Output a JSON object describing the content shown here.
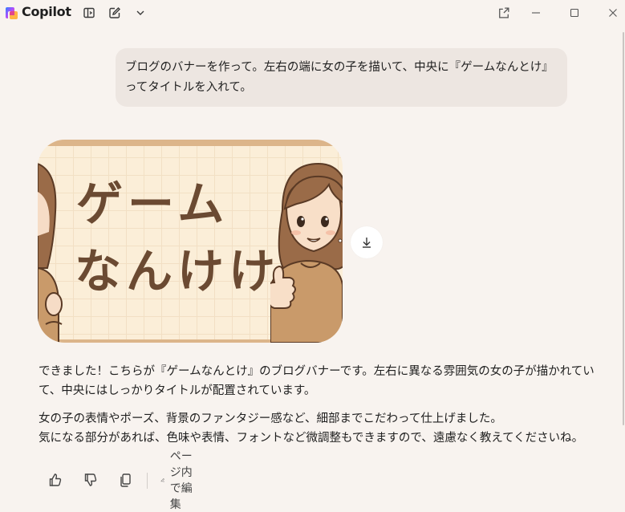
{
  "app": {
    "title": "Copilot"
  },
  "titlebar": {
    "icons": [
      "sidebar-toggle-icon",
      "new-chat-icon",
      "chevron-down-icon"
    ],
    "window_controls": [
      "pop-out-icon",
      "minimize-icon",
      "maximize-icon",
      "close-icon"
    ]
  },
  "conversation": {
    "user_message": "ブログのバナーを作って。左右の端に女の子を描いて、中央に『ゲームなんとけ』ってタイトルを入れて。",
    "banner": {
      "title_line1": "ゲーム",
      "title_line2": "なんけけ"
    },
    "response_paragraph1": "できました！こちらが『ゲームなんとけ』のブログバナーです。左右に異なる雰囲気の女の子が描かれていて、中央にはしっかりタイトルが配置されています。",
    "response_paragraph2_line1": "女の子の表情やポーズ、背景のファンタジー感など、細部までこだわって仕上げました。",
    "response_paragraph2_line2": "気になる部分があれば、色味や表情、フォントなど微調整もできますので、遠慮なく教えてくださいね。"
  },
  "actions": {
    "edit_label": "ページ内で編集"
  }
}
